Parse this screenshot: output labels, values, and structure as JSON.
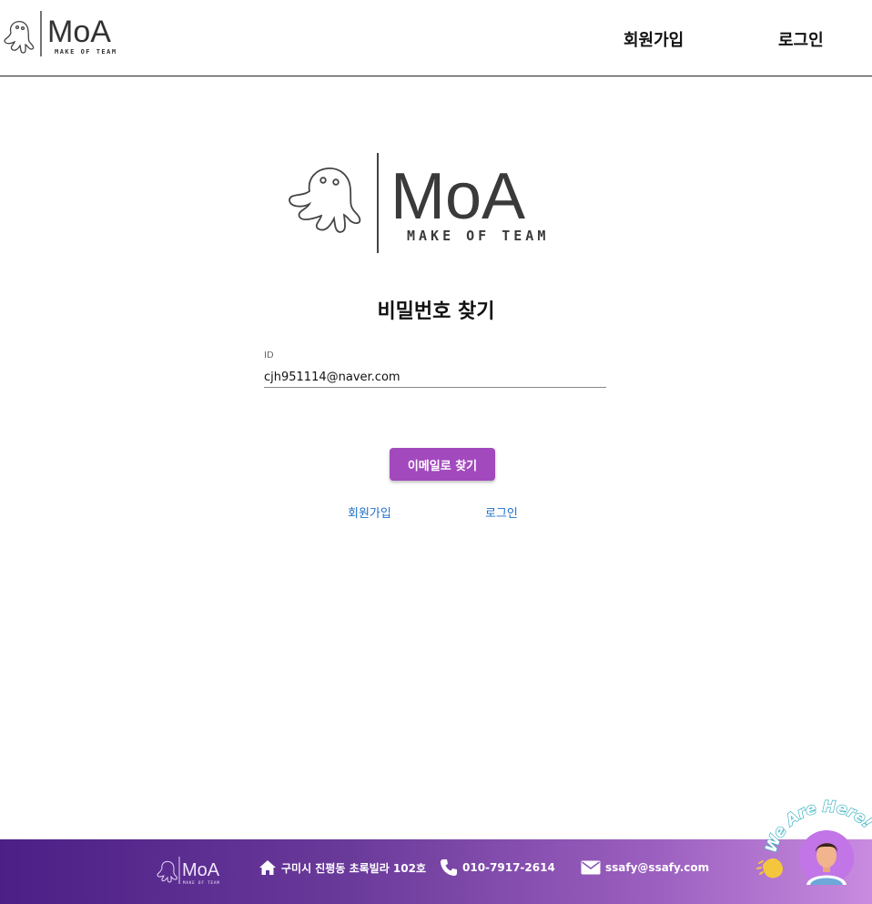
{
  "header": {
    "logo_text": "MoA",
    "logo_tagline": "MAKE OF TEAM",
    "nav": {
      "signup_label": "회원가입",
      "login_label": "로그인"
    }
  },
  "main": {
    "logo_text": "MoA",
    "logo_tagline": "MAKE OF TEAM",
    "title": "비밀번호 찾기",
    "id_field": {
      "label": "ID",
      "value": "cjh951114@naver.com"
    },
    "find_button_label": "이메일로 찾기",
    "links": {
      "signup_label": "회원가입",
      "login_label": "로그인"
    }
  },
  "footer": {
    "logo_text": "MoA",
    "logo_tagline": "MAKE OF TEAM",
    "address": "구미시 진평동 초록빌라 102호",
    "phone": "010-7917-2614",
    "email": "ssafy@ssafy.com"
  },
  "chat_widget": {
    "banner_text": "We Are Here!"
  },
  "colors": {
    "accent": "#a349be",
    "link": "#1e6fc8",
    "footer_start": "#4b1f86",
    "footer_end": "#c88be0"
  }
}
